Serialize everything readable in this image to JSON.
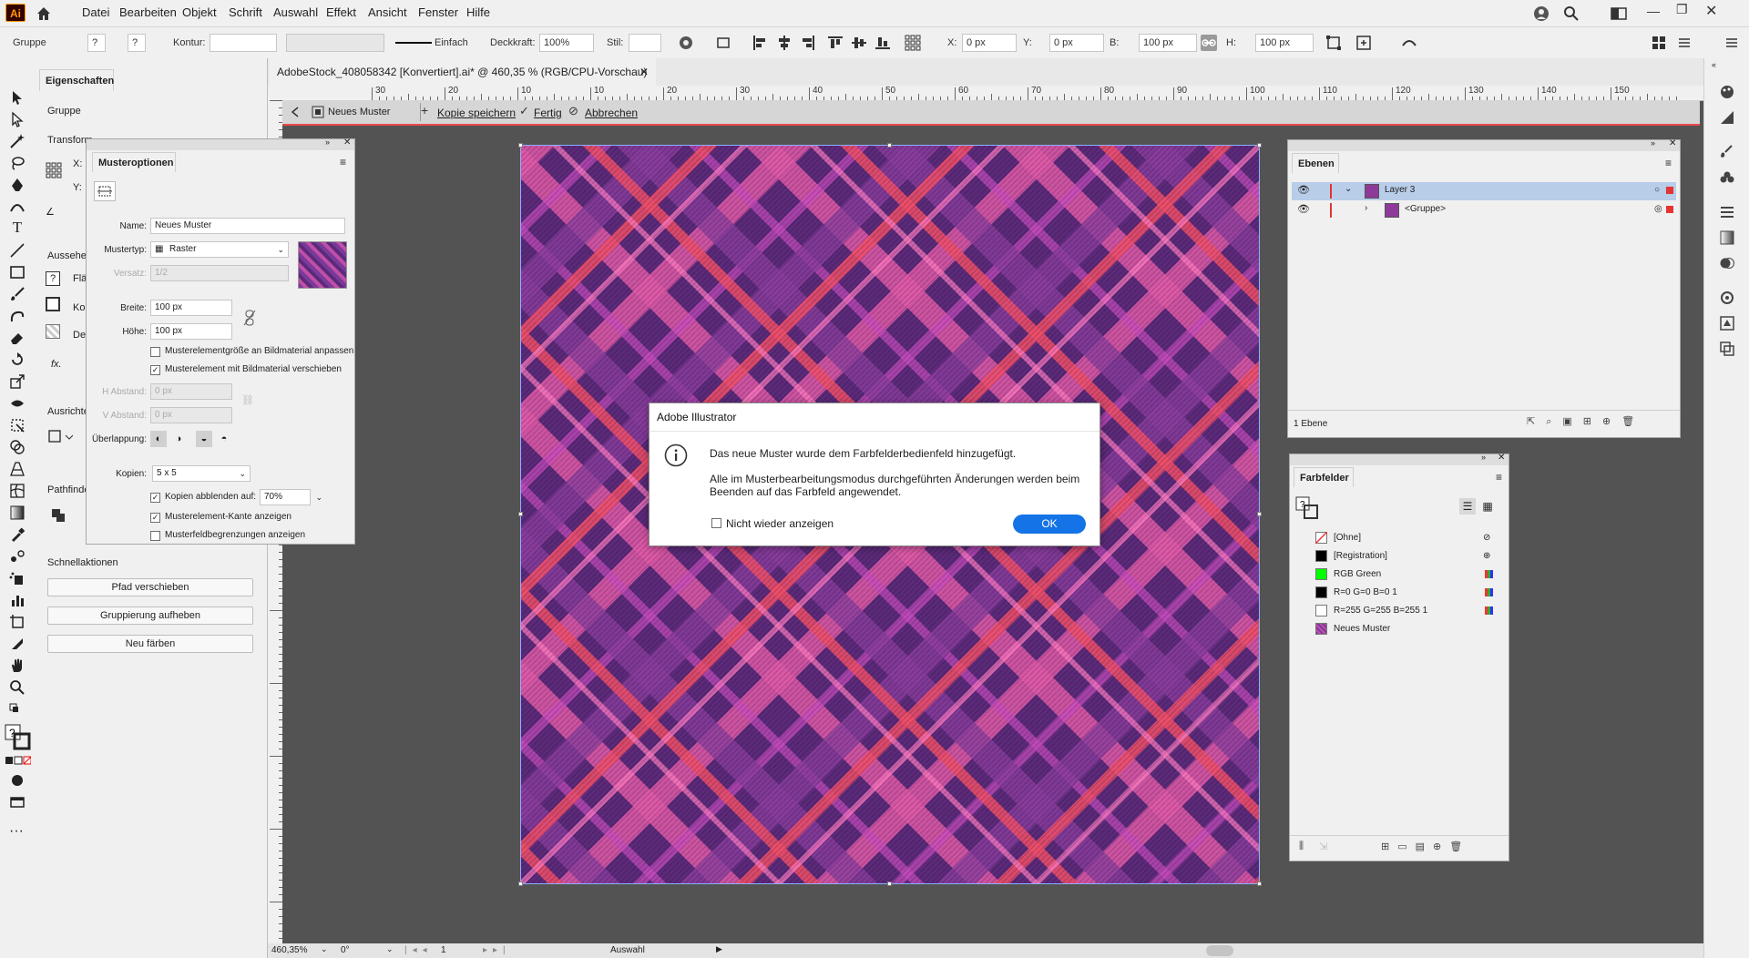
{
  "app": {
    "logo": "Ai",
    "accent": "#ff9a00",
    "doc_title": "AdobeStock_408058342 [Konvertiert].ai* @ 460,35 % (RGB/CPU-Vorschau)"
  },
  "menu": [
    "Datei",
    "Bearbeiten",
    "Objekt",
    "Schrift",
    "Auswahl",
    "Effekt",
    "Ansicht",
    "Fenster",
    "Hilfe"
  ],
  "control": {
    "selection": "Gruppe",
    "kontur_label": "Kontur:",
    "stroke_style": "Einfach",
    "deckkraft_label": "Deckkraft:",
    "deckkraft_value": "100%",
    "stil_label": "Stil:",
    "x_label": "X:",
    "x_value": "0 px",
    "y_label": "Y:",
    "y_value": "0 px",
    "b_label": "B:",
    "b_value": "100 px",
    "h_label": "H:",
    "h_value": "100 px"
  },
  "pattern_bar": {
    "name": "Neues Muster",
    "save_copy": "Kopie speichern",
    "done": "Fertig",
    "cancel": "Abbrechen"
  },
  "properties": {
    "tab": "Eigenschaften",
    "group": "Gruppe",
    "transform": "Transform",
    "x": "X:",
    "y": "Y:",
    "aussehen": "Aussehen",
    "flaeche": "Flä",
    "kontur": "Ko",
    "deckkraft": "De",
    "fx": "fx.",
    "ausrichten": "Ausrichte",
    "pathfinder": "Pathfinde",
    "schnellaktionen": "Schnellaktionen",
    "btn_path": "Pfad verschieben",
    "btn_ungroup": "Gruppierung aufheben",
    "btn_recolor": "Neu färben"
  },
  "muster": {
    "title": "Musteroptionen",
    "name_label": "Name:",
    "name_value": "Neues Muster",
    "type_label": "Mustertyp:",
    "type_value": "Raster",
    "offset_label": "Versatz:",
    "offset_value": "1/2",
    "width_label": "Breite:",
    "width_value": "100 px",
    "height_label": "Höhe:",
    "height_value": "100 px",
    "chk1": "Musterelementgröße an Bildmaterial anpassen",
    "chk2": "Musterelement mit Bildmaterial verschieben",
    "hgap_label": "H Abstand:",
    "hgap_value": "0 px",
    "vgap_label": "V Abstand:",
    "vgap_value": "0 px",
    "overlap_label": "Überlappung:",
    "copies_label": "Kopien:",
    "copies_value": "5 x 5",
    "dim_label": "Kopien abblenden auf:",
    "dim_value": "70%",
    "chk3": "Musterelement-Kante anzeigen",
    "chk4": "Musterfeldbegrenzungen anzeigen"
  },
  "ebenen": {
    "title": "Ebenen",
    "rows": [
      {
        "label": "Layer 3"
      },
      {
        "label": "<Gruppe>"
      }
    ],
    "footer": "1 Ebene"
  },
  "farbfelder": {
    "title": "Farbfelder",
    "rows": [
      {
        "label": "[Ohne]",
        "color": "#ffffff"
      },
      {
        "label": "[Registration]",
        "color": "#000000"
      },
      {
        "label": "RGB Green",
        "color": "#00ff00"
      },
      {
        "label": "R=0 G=0 B=0 1",
        "color": "#000000"
      },
      {
        "label": "R=255 G=255 B=255 1",
        "color": "#ffffff"
      },
      {
        "label": "Neues Muster",
        "color": "#8e3a9a"
      }
    ]
  },
  "dialog": {
    "title": "Adobe Illustrator",
    "msg1": "Das neue Muster wurde dem Farbfelderbedienfeld hinzugefügt.",
    "msg2a": "Alle im Musterbearbeitungsmodus durchgeführten Änderungen werden beim",
    "msg2b": "Beenden auf das Farbfeld angewendet.",
    "checkbox": "Nicht wieder anzeigen",
    "ok": "OK"
  },
  "status": {
    "zoom": "460,35%",
    "rotation": "0°",
    "artboard": "1",
    "mode": "Auswahl"
  },
  "ruler_ticks": [
    "30",
    "20",
    "10",
    "10",
    "20",
    "30",
    "40",
    "50",
    "60",
    "70",
    "80",
    "90",
    "100",
    "110",
    "120",
    "130",
    "140",
    "150"
  ]
}
